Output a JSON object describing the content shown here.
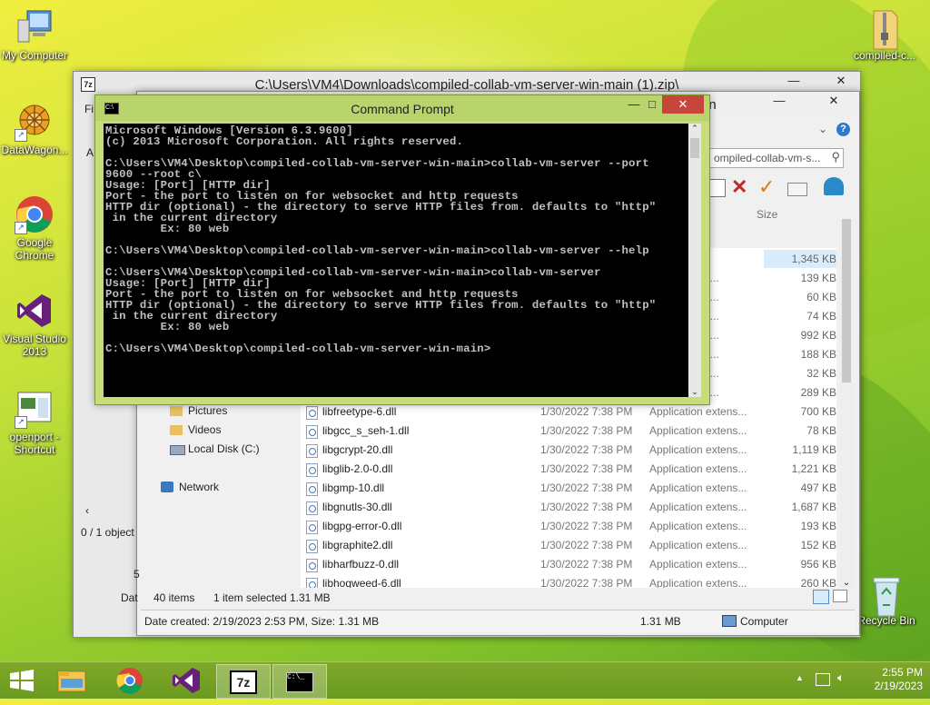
{
  "desktop": {
    "icons": [
      {
        "label": "My Computer"
      },
      {
        "label": "DataWagon..."
      },
      {
        "label": "Google Chrome"
      },
      {
        "label": "Visual Studio 2013"
      },
      {
        "label": "openport - Shortcut"
      },
      {
        "label": "compiled-c..."
      },
      {
        "label": "Recycle Bin"
      }
    ]
  },
  "zip_window": {
    "title": "C:\\Users\\VM4\\Downloads\\compiled-collab-vm-server-win-main (1).zip\\",
    "status": "0 / 1 object",
    "menu_fragment": "Fi",
    "side_letter": "N",
    "side_letter2": "A"
  },
  "explorer": {
    "title_fragment": "in",
    "address": "ompiled-collab-vm-s...",
    "size_header": "Size",
    "first_size": "1,345 KB",
    "nav": [
      {
        "label": "Pictures"
      },
      {
        "label": "Videos"
      },
      {
        "label": "Local Disk (C:)"
      },
      {
        "label": "Network"
      }
    ],
    "rows_partial": [
      {
        "type": "xtens...",
        "size": "139 KB"
      },
      {
        "type": "xtens...",
        "size": "60 KB"
      },
      {
        "type": "xtens...",
        "size": "74 KB"
      },
      {
        "type": "xtens...",
        "size": "992 KB"
      },
      {
        "type": "xtens...",
        "size": "188 KB"
      },
      {
        "type": "xtens...",
        "size": "32 KB"
      },
      {
        "type": "xtens...",
        "size": "289 KB"
      }
    ],
    "rows": [
      {
        "name": "libfreetype-6.dll",
        "date": "1/30/2022 7:38 PM",
        "type": "Application extens...",
        "size": "700 KB"
      },
      {
        "name": "libgcc_s_seh-1.dll",
        "date": "1/30/2022 7:38 PM",
        "type": "Application extens...",
        "size": "78 KB"
      },
      {
        "name": "libgcrypt-20.dll",
        "date": "1/30/2022 7:38 PM",
        "type": "Application extens...",
        "size": "1,119 KB"
      },
      {
        "name": "libglib-2.0-0.dll",
        "date": "1/30/2022 7:38 PM",
        "type": "Application extens...",
        "size": "1,221 KB"
      },
      {
        "name": "libgmp-10.dll",
        "date": "1/30/2022 7:38 PM",
        "type": "Application extens...",
        "size": "497 KB"
      },
      {
        "name": "libgnutls-30.dll",
        "date": "1/30/2022 7:38 PM",
        "type": "Application extens...",
        "size": "1,687 KB"
      },
      {
        "name": "libgpg-error-0.dll",
        "date": "1/30/2022 7:38 PM",
        "type": "Application extens...",
        "size": "193 KB"
      },
      {
        "name": "libgraphite2.dll",
        "date": "1/30/2022 7:38 PM",
        "type": "Application extens...",
        "size": "152 KB"
      },
      {
        "name": "libharfbuzz-0.dll",
        "date": "1/30/2022 7:38 PM",
        "type": "Application extens...",
        "size": "956 KB"
      },
      {
        "name": "libhogweed-6.dll",
        "date": "1/30/2022 7:38 PM",
        "type": "Application extens...",
        "size": "260 KB"
      }
    ],
    "status_items": "40 items",
    "status_selected": "1 item selected",
    "status_size": "1.31 MB",
    "details": "Date created: 2/19/2023 2:53 PM, Size: 1.31 MB",
    "details_size": "1.31 MB",
    "details_location": "Computer",
    "side_letter": "5",
    "side_letters2": "Dat"
  },
  "cmd": {
    "title": "Command Prompt",
    "text": "Microsoft Windows [Version 6.3.9600]\n(c) 2013 Microsoft Corporation. All rights reserved.\n\nC:\\Users\\VM4\\Desktop\\compiled-collab-vm-server-win-main>collab-vm-server --port\n9600 --root c\\\nUsage: [Port] [HTTP dir]\nPort - the port to listen on for websocket and http requests\nHTTP dir (optional) - the directory to serve HTTP files from. defaults to \"http\"\n in the current directory\n        Ex: 80 web\n\nC:\\Users\\VM4\\Desktop\\compiled-collab-vm-server-win-main>collab-vm-server --help\n\nC:\\Users\\VM4\\Desktop\\compiled-collab-vm-server-win-main>collab-vm-server\nUsage: [Port] [HTTP dir]\nPort - the port to listen on for websocket and http requests\nHTTP dir (optional) - the directory to serve HTTP files from. defaults to \"http\"\n in the current directory\n        Ex: 80 web\n\nC:\\Users\\VM4\\Desktop\\compiled-collab-vm-server-win-main>"
  },
  "taskbar": {
    "time": "2:55 PM",
    "date": "2/19/2023",
    "apps": [
      "file-explorer",
      "chrome",
      "visual-studio",
      "7zip",
      "command-prompt"
    ],
    "seven_zip_label": "7z"
  },
  "colors": {
    "cmd_frame": "#c8dd7a",
    "close_red": "#c7463c",
    "taskbar": "#6a9a20"
  }
}
